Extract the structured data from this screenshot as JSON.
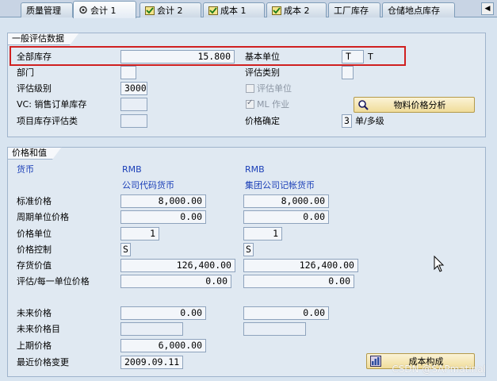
{
  "tabs": [
    {
      "label": "质量管理",
      "icon": "none",
      "active": false
    },
    {
      "label": "会计 1",
      "icon": "eye-icon",
      "active": true
    },
    {
      "label": "会计 2",
      "icon": "check-icon",
      "active": false
    },
    {
      "label": "成本 1",
      "icon": "check-icon",
      "active": false
    },
    {
      "label": "成本 2",
      "icon": "check-icon",
      "active": false
    },
    {
      "label": "工厂库存",
      "icon": "none",
      "active": false
    },
    {
      "label": "仓储地点库存",
      "icon": "none",
      "active": false
    }
  ],
  "general": {
    "title": "一般评估数据",
    "total_stock_label": "全部库存",
    "total_stock_value": "15.800",
    "base_unit_label": "基本单位",
    "base_unit_value": "T",
    "base_unit_text": "T",
    "division_label": "部门",
    "division_value": "",
    "valuation_category_label": "评估类别",
    "valuation_category_value": "",
    "valuation_class_label": "评估级别",
    "valuation_class_value": "3000",
    "valuation_unit_label": "评估单位",
    "vc_label": "VC: 销售订单库存",
    "vc_value": "",
    "ml_label": "ML 作业",
    "project_stock_label": "项目库存评估类",
    "project_stock_value": "",
    "price_determination_label": "价格确定",
    "price_determination_value": "3",
    "price_determination_text": "单/多级",
    "material_price_analysis_button": "物料价格分析"
  },
  "prices": {
    "title": "价格和值",
    "currency_label": "货币",
    "currency_1": "RMB",
    "currency_2": "RMB",
    "col1_header": "公司代码货币",
    "col2_header": "集团公司记帐货币",
    "rows": {
      "standard_price": {
        "label": "标准价格",
        "v1": "8,000.00",
        "v2": "8,000.00"
      },
      "periodic_unit_price": {
        "label": "周期单位价格",
        "v1": "0.00",
        "v2": "0.00"
      },
      "price_unit": {
        "label": "价格单位",
        "v1": "1",
        "v2": "1"
      },
      "price_control": {
        "label": "价格控制",
        "v1": "S",
        "v2": "S"
      },
      "inventory_value": {
        "label": "存货价值",
        "v1": "126,400.00",
        "v2": "126,400.00"
      },
      "valuation_per_unit": {
        "label": "评估/每一单位价格",
        "v1": "0.00",
        "v2": "0.00"
      },
      "future_price": {
        "label": "未来价格",
        "v1": "0.00",
        "v2": "0.00"
      },
      "future_price_date": {
        "label": "未来价格目",
        "v1": "",
        "v2": ""
      },
      "previous_price": {
        "label": "上期价格",
        "v1": "6,000.00"
      },
      "last_price_change": {
        "label": "最近价格变更",
        "v1": "2009.09.11"
      }
    },
    "cost_estimate_button": "成本构成"
  },
  "watermark": "CSDN @SAPmatinal",
  "colors": {
    "highlight": "#d02020",
    "label_blue": "#1c40b8",
    "button_yellow": "#f0dc9a"
  }
}
